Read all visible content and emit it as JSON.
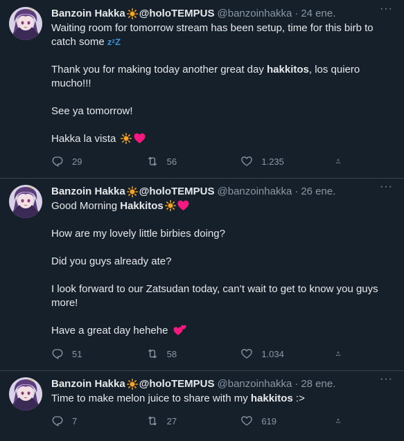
{
  "tweets": [
    {
      "name": "Banzoin Hakka",
      "display_tag": "@holoTEMPUS",
      "handle": "@banzoinhakka",
      "separator": "·",
      "date": "24 ene.",
      "lines": {
        "l1": "Waiting room for tomorrow stream has been setup, time for this birb to catch some ",
        "l1_emoji": "zᶻZ",
        "l2a": "Thank you for making today another great day ",
        "l2b": "hakkitos",
        "l2c": ", los quiero mucho!!!",
        "l3": "See ya tomorrow!",
        "l4": "Hakka la vista "
      },
      "replies": "29",
      "retweets": "56",
      "likes": "1.235"
    },
    {
      "name": "Banzoin Hakka",
      "display_tag": "@holoTEMPUS",
      "handle": "@banzoinhakka",
      "separator": "·",
      "date": "26 ene.",
      "lines": {
        "l1a": "Good Morning ",
        "l1b": "Hakkitos",
        "l2": "How are my lovely little birbies doing?",
        "l3": "Did you guys already ate?",
        "l4": "I look forward to our Zatsudan today, can’t wait to get to know you guys more!",
        "l5": "Have a great day hehehe "
      },
      "replies": "51",
      "retweets": "58",
      "likes": "1.034"
    },
    {
      "name": "Banzoin Hakka",
      "display_tag": "@holoTEMPUS",
      "handle": "@banzoinhakka",
      "separator": "·",
      "date": "28 ene.",
      "lines": {
        "l1a": "Time to make melon juice to share with my ",
        "l1b": "hakkitos",
        "l1c": " :>"
      },
      "replies": "7",
      "retweets": "27",
      "likes": "619"
    }
  ],
  "more_label": "···",
  "colors": {
    "background": "#15202b",
    "text": "#e7e9ea",
    "muted": "#8b98a5",
    "heart": "#f91880",
    "sun": "#f5a623"
  }
}
